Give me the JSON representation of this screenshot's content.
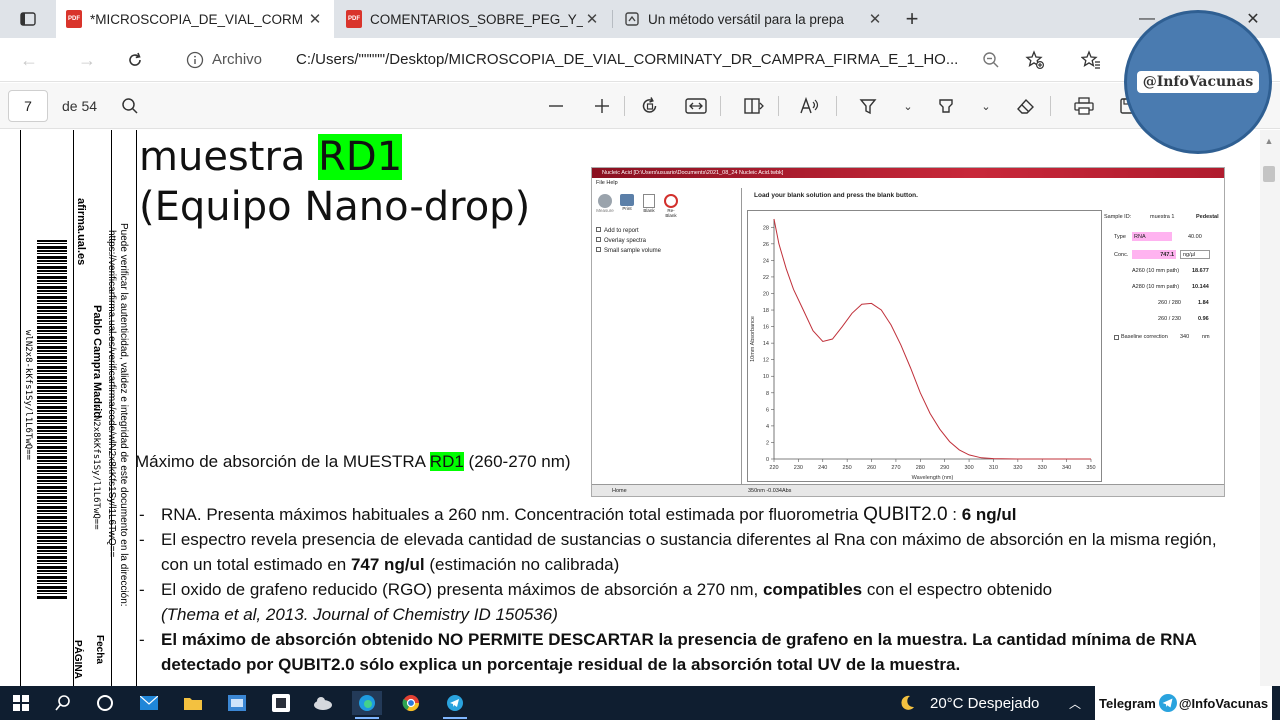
{
  "browser": {
    "tabs": [
      {
        "title": "*MICROSCOPIA_DE_VIAL_CORM",
        "icon": "pdf-icon",
        "active": true
      },
      {
        "title": "COMENTARIOS_SOBRE_PEG_Y_S",
        "icon": "pdf-icon",
        "active": false
      },
      {
        "title": "Un método versátil para la prepa",
        "icon": "web-icon",
        "active": false
      }
    ],
    "new_tab_label": "+",
    "address": {
      "label": "Archivo",
      "url": "C:/Users/\"\"\"\"\"/Desktop/MICROSCOPIA_DE_VIAL_CORMINATY_DR_CAMPRA_FIRMA_E_1_HO..."
    }
  },
  "pdf_toolbar": {
    "page_current": "7",
    "page_of": "de 54"
  },
  "document": {
    "title_line1_prefix": "muestra ",
    "title_line1_highlight": "RD1",
    "title_line2": "(Equipo Nano-drop)",
    "abs_max_prefix": "Máximo de absorción de la MUESTRA ",
    "abs_max_highlight": "RD1",
    "abs_max_suffix": " (260-270 nm)",
    "bullets": {
      "b1_text": "RNA. Presenta máximos habituales a 260 nm.  Concentración total estimada por fluorometria ",
      "b1_qubit": "QUBIT2.0",
      "b1_colon": " : ",
      "b1_bold": "6 ng/ul",
      "b2_text": "El espectro revela presencia de elevada cantidad de sustancias o sustancia diferentes al Rna con máximo de absorción en la misma región, con un total estimado en ",
      "b2_bold": "747 ng/ul",
      "b2_suffix": " (estimación no calibrada)",
      "b3_text": "El oxido de grafeno reducido (RGO) presenta máximos de absorción a 270 nm, ",
      "b3_bold": "compatibles",
      "b3_suffix": " con el espectro obtenido",
      "b3_cite": "(Thema et al, 2013. Journal of Chemistry  ID 150536)",
      "b4_bold": "El máximo de absorción obtenido NO PERMITE DESCARTAR la presencia de grafeno en la muestra. La cantidad mínima de RNA detectado por QUBIT2.0 sólo explica un porcentaje residual de la absorción total UV de la muestra."
    },
    "margin": {
      "site": "afirma.ual.es",
      "signer": "Pablo Campra Madrid",
      "verify": "Puede verificar la autenticidad, validez e integridad de este documento en la dirección:",
      "verify_url": "https://verificarfirma.ual.es/verificarfirma/code/wlN2x8kKfs1Sy/l1L6TwQ==",
      "code1": "wlN2x8-kKfs1Sy/l1L6TwQ==",
      "code2": "wlN2x8kKfs1Sy/l1L6TwQ==",
      "fecha": "Fecha",
      "pagina": "PÁGINA"
    }
  },
  "nanodrop": {
    "window_title": "Nucleic Acid  [D:\\Users\\usuario\\Documents\\2021_08_24 Nucleic Acid.twbk]",
    "menu": "File   Help",
    "sidebar_buttons": [
      "Measure",
      "Print",
      "Blank",
      "Re-Blank"
    ],
    "options": [
      "Add to report",
      "Overlay spectra",
      "Small sample volume"
    ],
    "message": "Load your blank solution and press the blank button.",
    "sample_id_label": "Sample ID:",
    "sample_id_value": "muestra 1",
    "pedestal": "Pedestal",
    "type_label": "Type",
    "type_value": "RNA",
    "type_factor": "40.00",
    "conc_label": "Conc.",
    "conc_value": "747.1",
    "conc_unit": "ng/µl",
    "a260_label": "A260 (10 mm path)",
    "a260_value": "18.677",
    "a280_label": "A280 (10 mm path)",
    "a280_value": "10.144",
    "r260_280_label": "260 / 280",
    "r260_280_value": "1.84",
    "r260_230_label": "260 / 230",
    "r260_230_value": "0.96",
    "baseline_label": "Baseline correction",
    "baseline_value": "340",
    "baseline_unit": "nm",
    "status": "350nm -0.034Abs",
    "home_label": "Home",
    "y_axis_label": "10mm Absorbance",
    "x_axis_label": "Wavelength (nm)",
    "x_ticks": [
      "220",
      "230",
      "240",
      "250",
      "260",
      "270",
      "280",
      "290",
      "300",
      "310",
      "320",
      "330",
      "340",
      "350"
    ],
    "y_ticks": [
      "0",
      "2",
      "4",
      "6",
      "8",
      "10",
      "12",
      "14",
      "16",
      "18",
      "20",
      "22",
      "24",
      "26",
      "28"
    ],
    "spectrum": {
      "x": [
        220,
        222,
        225,
        228,
        232,
        236,
        240,
        244,
        248,
        252,
        256,
        260,
        264,
        268,
        272,
        276,
        280,
        284,
        288,
        292,
        296,
        300,
        305,
        310,
        320,
        330,
        340,
        350
      ],
      "y": [
        29,
        26,
        23,
        20.5,
        18,
        15.5,
        14.2,
        14.5,
        16,
        17.6,
        18.7,
        18.8,
        18,
        16.2,
        13.8,
        11,
        8,
        5.5,
        3.6,
        2.1,
        1.1,
        0.5,
        0.15,
        0.05,
        0,
        0,
        0,
        0
      ]
    }
  },
  "overlay": {
    "watermark": "@InfoVacunas",
    "telegram": "Telegram",
    "telegram_handle": "@InfoVacunas"
  },
  "taskbar": {
    "weather": "20°C  Despejado"
  }
}
